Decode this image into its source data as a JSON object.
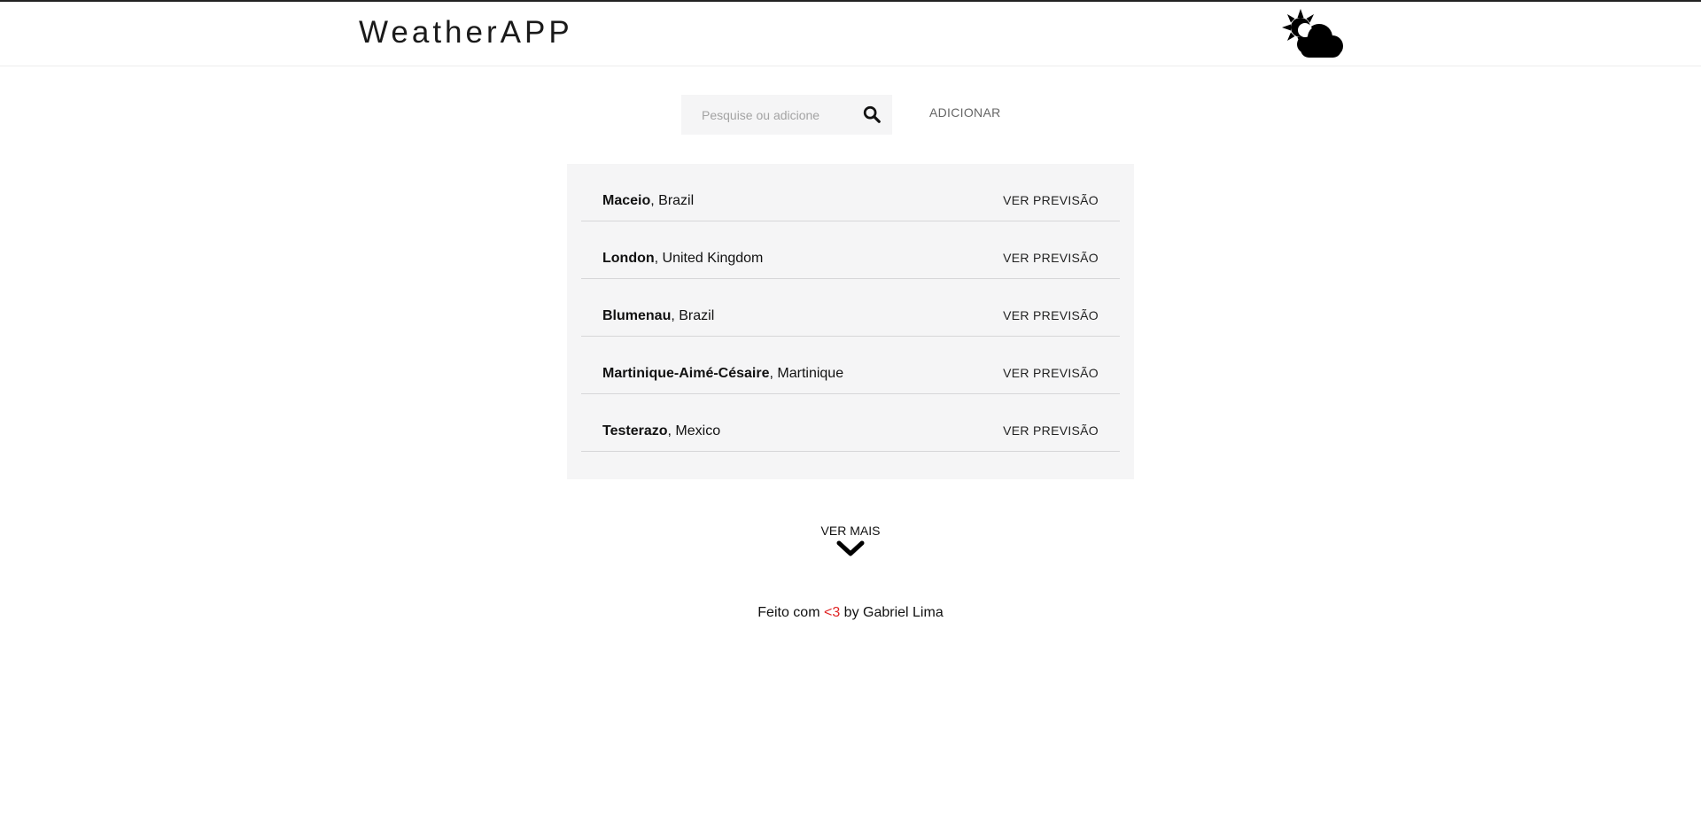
{
  "header": {
    "brand": "WeatherAPP",
    "logo_icon": "sun-cloud-icon"
  },
  "search": {
    "placeholder": "Pesquise ou adicione",
    "value": "",
    "search_icon": "search-icon",
    "add_label": "ADICIONAR"
  },
  "cities": [
    {
      "name": "Maceio",
      "country": ", Brazil",
      "action": "VER PREVISÃO"
    },
    {
      "name": "London",
      "country": ", United Kingdom",
      "action": "VER PREVISÃO"
    },
    {
      "name": "Blumenau",
      "country": ", Brazil",
      "action": "VER PREVISÃO"
    },
    {
      "name": "Martinique-Aimé-Césaire",
      "country": ", Martinique",
      "action": "VER PREVISÃO"
    },
    {
      "name": "Testerazo",
      "country": ", Mexico",
      "action": "VER PREVISÃO"
    }
  ],
  "more": {
    "label": "VER MAIS",
    "icon": "chevron-down-icon"
  },
  "footer": {
    "prefix": "Feito com ",
    "heart": "<3",
    "suffix": " by Gabriel Lima"
  },
  "colors": {
    "panel_bg": "#f5f5f6",
    "heart": "#e02424",
    "text": "#111111"
  }
}
